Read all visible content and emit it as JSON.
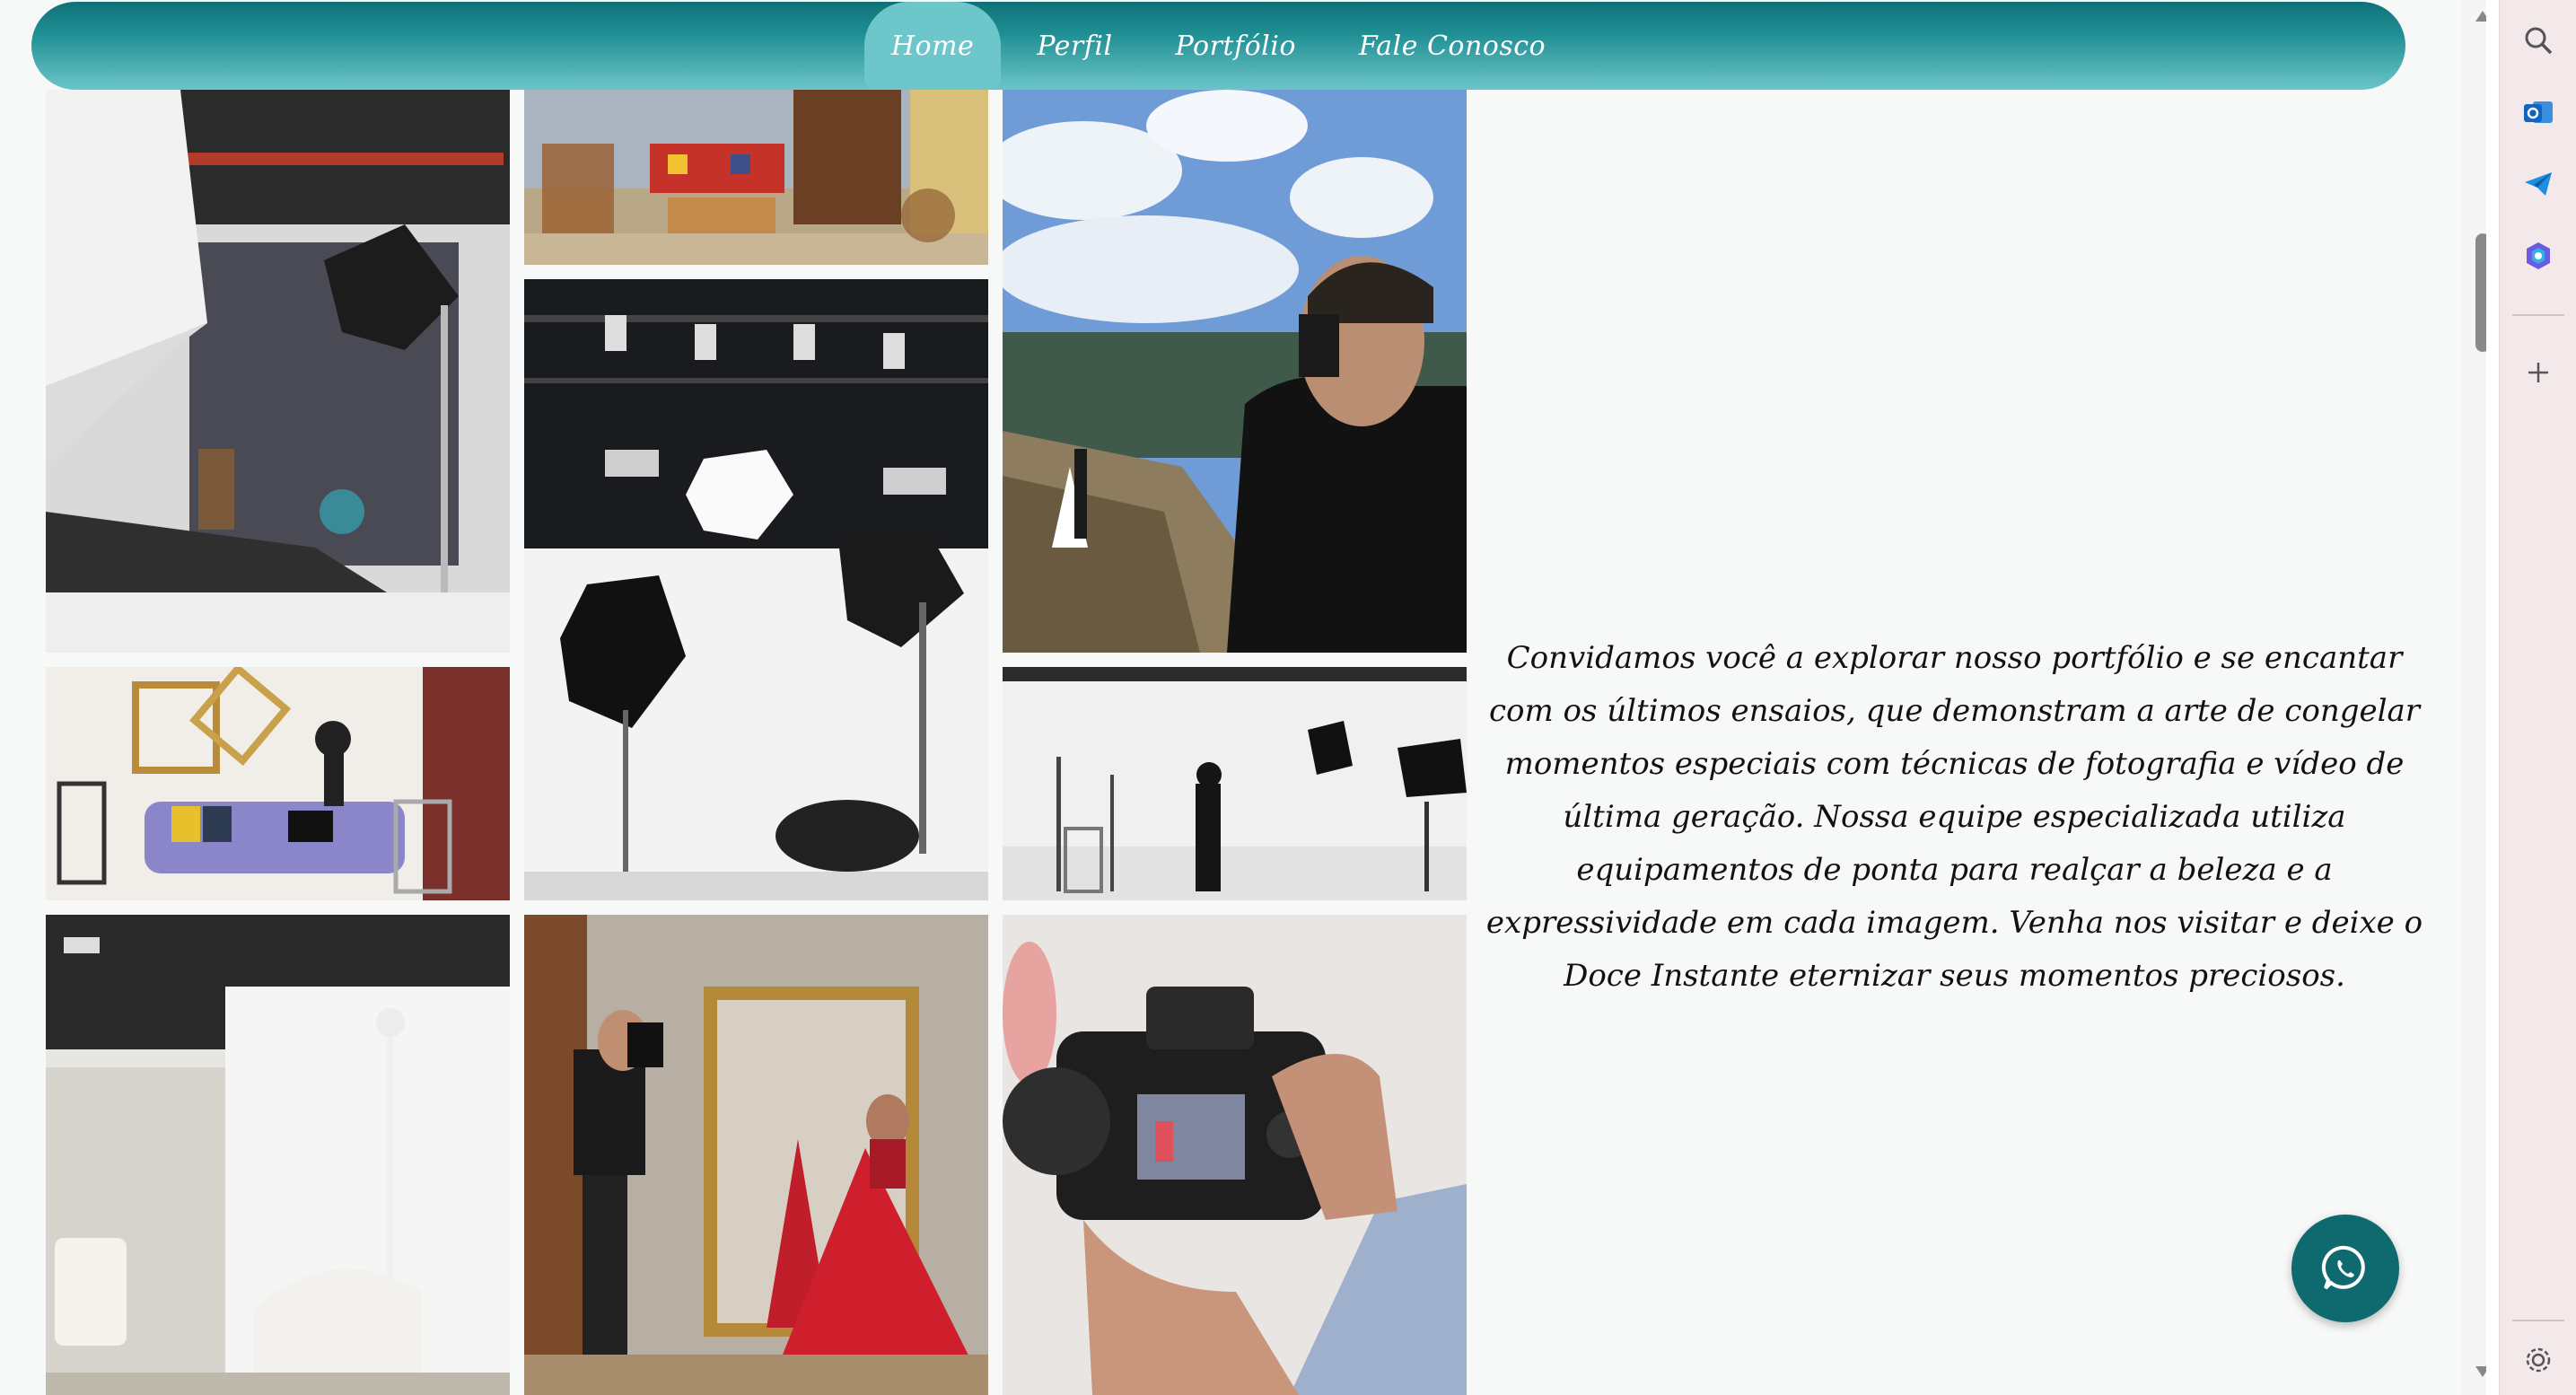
{
  "nav": {
    "items": [
      {
        "label": "Home",
        "active": true
      },
      {
        "label": "Perfil",
        "active": false
      },
      {
        "label": "Portfólio",
        "active": false
      },
      {
        "label": "Fale Conosco",
        "active": false
      }
    ]
  },
  "gallery": {
    "images": [
      {
        "name": "studio-softbox-photo",
        "description_icon": "photo"
      },
      {
        "name": "vintage-living-room-photo",
        "description_icon": "photo"
      },
      {
        "name": "wedding-cliff-photographer-photo",
        "description_icon": "photo"
      },
      {
        "name": "lighting-studio-photo",
        "description_icon": "photo"
      },
      {
        "name": "purple-sofa-room-photo",
        "description_icon": "photo"
      },
      {
        "name": "white-studio-photographer-photo",
        "description_icon": "photo"
      },
      {
        "name": "white-curtain-room-photo",
        "description_icon": "photo"
      },
      {
        "name": "red-dress-mirror-photo",
        "description_icon": "photo"
      },
      {
        "name": "camera-in-hands-photo",
        "description_icon": "photo"
      }
    ]
  },
  "about": {
    "text": "Convidamos você a explorar nosso portfólio e se encantar com os últimos ensaios, que demonstram a arte de congelar momentos especiais com técnicas de fotografia e vídeo de última geração. Nossa equipe especializada utiliza equipamentos de ponta para realçar a beleza e a expressividade em cada imagem. Venha nos visitar e deixe o Doce Instante eternizar seus momentos preciosos."
  },
  "colors": {
    "nav_dark": "#0f7178",
    "nav_light": "#6cc5c8",
    "whatsapp": "#0e6a6f",
    "sidebar": "#f3e9ea"
  },
  "browser_sidebar": {
    "icons": [
      "search-icon",
      "outlook-icon",
      "send-icon",
      "copilot-icon",
      "add-icon",
      "settings-icon"
    ]
  }
}
